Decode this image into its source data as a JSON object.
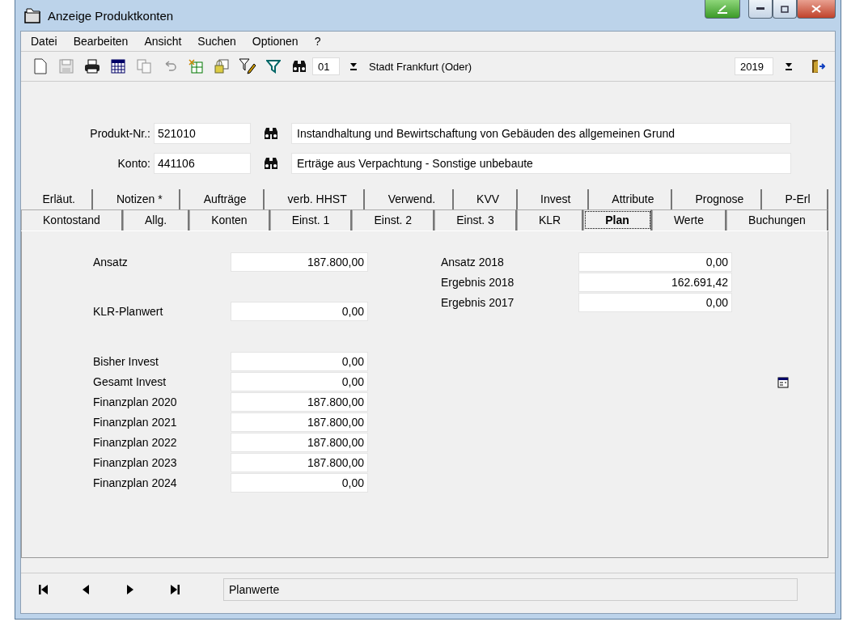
{
  "window": {
    "title": "Anzeige Produktkonten"
  },
  "menu": [
    "Datei",
    "Bearbeiten",
    "Ansicht",
    "Suchen",
    "Optionen",
    "?"
  ],
  "toolbar": [
    {
      "kind": "new",
      "disabled": false
    },
    {
      "kind": "save",
      "disabled": true
    },
    {
      "kind": "print",
      "disabled": false
    },
    {
      "kind": "calendar",
      "disabled": false
    },
    {
      "kind": "copy",
      "disabled": true
    },
    {
      "kind": "undo",
      "disabled": true
    },
    {
      "kind": "export",
      "disabled": false
    },
    {
      "kind": "lock",
      "disabled": false
    },
    {
      "kind": "filter-edit",
      "disabled": false
    },
    {
      "kind": "filter",
      "disabled": false
    },
    {
      "kind": "search",
      "disabled": false
    }
  ],
  "mandant": {
    "value": "01",
    "name": "Stadt Frankfurt (Oder)"
  },
  "year": {
    "value": "2019"
  },
  "header": [
    {
      "label": "Produkt-Nr.:",
      "value": "521010",
      "description": "Instandhaltung und Bewirtschaftung von Gebäuden des allgemeinen Grund"
    },
    {
      "label": "Konto:",
      "value": "441106",
      "description": "Erträge aus Verpachtung - Sonstige unbebaute"
    }
  ],
  "tab_rows": [
    [
      {
        "label": "Erläut.",
        "selected": false
      },
      {
        "label": "Notizen *",
        "selected": false
      },
      {
        "label": "Aufträge",
        "selected": false
      },
      {
        "label": "verb. HHST",
        "selected": false
      },
      {
        "label": "Verwend.",
        "selected": false
      },
      {
        "label": "KVV",
        "selected": false
      },
      {
        "label": "Invest",
        "selected": false
      },
      {
        "label": "Attribute",
        "selected": false
      },
      {
        "label": "Prognose",
        "selected": false
      },
      {
        "label": "P-Erl",
        "selected": false
      }
    ],
    [
      {
        "label": "Kontostand",
        "selected": false
      },
      {
        "label": "Allg.",
        "selected": false
      },
      {
        "label": "Konten",
        "selected": false
      },
      {
        "label": "Einst. 1",
        "selected": false
      },
      {
        "label": "Einst. 2",
        "selected": false
      },
      {
        "label": "Einst. 3",
        "selected": false
      },
      {
        "label": "KLR",
        "selected": false
      },
      {
        "label": "Plan",
        "selected": true
      },
      {
        "label": "Werte",
        "selected": false
      },
      {
        "label": "Buchungen",
        "selected": false
      }
    ]
  ],
  "plan_left": [
    [
      {
        "label": "Ansatz",
        "value": "187.800,00"
      }
    ],
    [
      {
        "label": "KLR-Planwert",
        "value": "0,00"
      }
    ],
    [
      {
        "label": "Bisher Invest",
        "value": "0,00"
      },
      {
        "label": "Gesamt Invest",
        "value": "0,00"
      },
      {
        "label": "Finanzplan 2020",
        "value": "187.800,00"
      },
      {
        "label": "Finanzplan 2021",
        "value": "187.800,00"
      },
      {
        "label": "Finanzplan 2022",
        "value": "187.800,00"
      },
      {
        "label": "Finanzplan 2023",
        "value": "187.800,00"
      },
      {
        "label": "Finanzplan 2024",
        "value": "0,00"
      }
    ]
  ],
  "plan_right": [
    {
      "label": "Ansatz 2018",
      "value": "0,00"
    },
    {
      "label": "Ergebnis 2018",
      "value": "162.691,42"
    },
    {
      "label": "Ergebnis 2017",
      "value": "0,00"
    }
  ],
  "status_bar": {
    "text": "Planwerte"
  }
}
